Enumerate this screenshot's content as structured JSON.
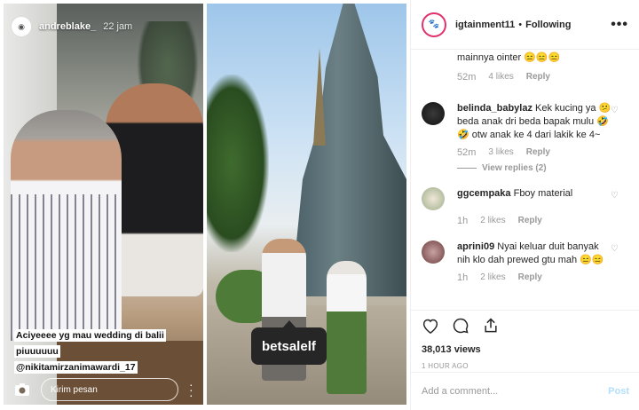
{
  "story": {
    "username": "andreblake_",
    "time": "22 jam",
    "caption_line1": "Aciyeeee yg mau wedding di balii piuuuuuu",
    "caption_line2": "@nikitamirzanimawardi_17",
    "message_placeholder": "Kirim pesan"
  },
  "photo": {
    "tag_label": "betsalelf"
  },
  "post": {
    "username": "igtainment11",
    "separator": "•",
    "follow_status": "Following",
    "more": "•••"
  },
  "comments": {
    "first_tail": "mainnya ointer 😑😑😑",
    "first_age": "52m",
    "first_likes": "4 likes",
    "items": [
      {
        "username": "belinda_babylaz",
        "text": "Kek kucing ya 😕 beda anak dri beda bapak mulu 🤣🤣 otw anak ke 4 dari lakik ke 4~",
        "age": "52m",
        "likes": "3 likes",
        "replies": "View replies (2)"
      },
      {
        "username": "ggcempaka",
        "text": "Fboy material",
        "age": "1h",
        "likes": "2 likes"
      },
      {
        "username": "aprini09",
        "text": "Nyai keluar duit banyak nih klo dah prewed gtu mah 😑😑",
        "age": "1h",
        "likes": "2 likes"
      }
    ],
    "reply_label": "Reply"
  },
  "stats": {
    "views": "38,013 views",
    "posted": "1 HOUR AGO"
  },
  "composer": {
    "placeholder": "Add a comment...",
    "post_label": "Post"
  },
  "colors": {
    "accent_blue": "#b2dffc",
    "muted": "#999999"
  },
  "icons": [
    "camera-icon",
    "heart-icon",
    "comment-icon",
    "share-icon",
    "more-icon"
  ]
}
